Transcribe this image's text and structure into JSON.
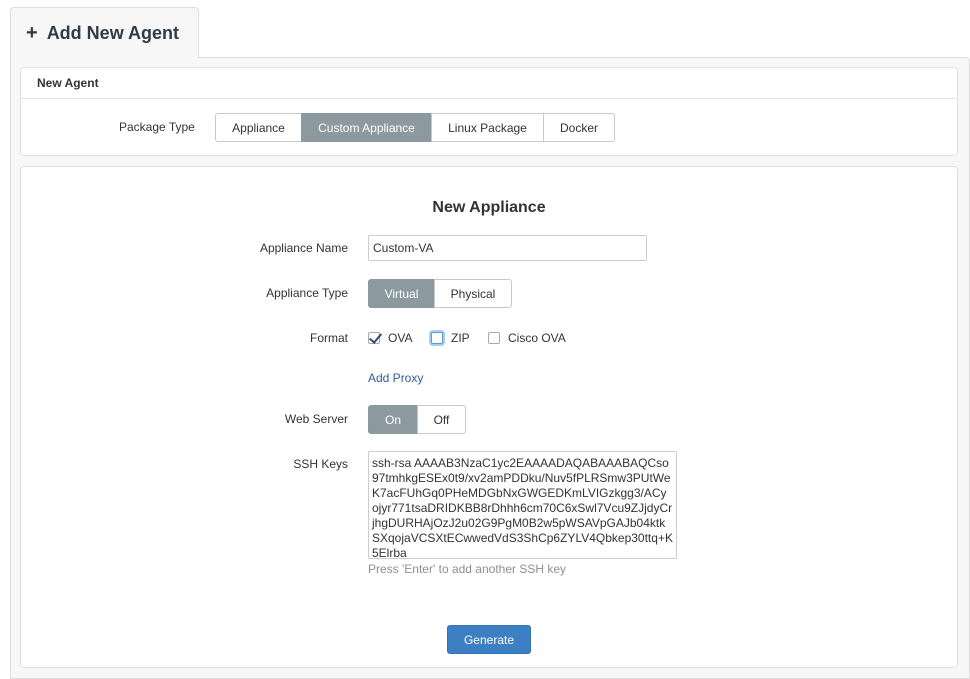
{
  "tab": {
    "icon": "plus-icon",
    "plus": "+",
    "title": "Add New Agent"
  },
  "new_agent": {
    "heading": "New Agent",
    "package_type_label": "Package Type",
    "package_types": [
      "Appliance",
      "Custom Appliance",
      "Linux Package",
      "Docker"
    ],
    "selected_package_type": "Custom Appliance"
  },
  "form": {
    "title": "New Appliance",
    "appliance_name_label": "Appliance Name",
    "appliance_name_value": "Custom-VA",
    "appliance_type_label": "Appliance Type",
    "appliance_types": [
      "Virtual",
      "Physical"
    ],
    "selected_appliance_type": "Virtual",
    "format_label": "Format",
    "formats": [
      {
        "label": "OVA",
        "checked": true
      },
      {
        "label": "ZIP",
        "checked": false
      },
      {
        "label": "Cisco OVA",
        "checked": false
      }
    ],
    "add_proxy": "Add Proxy",
    "web_server_label": "Web Server",
    "web_server_options": [
      "On",
      "Off"
    ],
    "selected_web_server": "On",
    "ssh_keys_label": "SSH Keys",
    "ssh_keys_value": "ssh-rsa AAAAB3NzaC1yc2EAAAADAQABAAABAQCso97tmhkgESEx0t9/xv2amPDDku/Nuv5fPLRSmw3PUtWeK7acFUhGq0PHeMDGbNxGWGEDKmLVIGzkgg3/ACyojyr771tsaDRIDKBB8rDhhh6cm70C6xSwl7Vcu9ZJjdyCrjhgDURHAjOzJ2u02G9PgM0B2w5pWSAVpGAJb04ktkSXqojaVCSXtECwwedVdS3ShCp6ZYLV4Qbkep30ttq+K5Elrba",
    "ssh_hint": "Press 'Enter' to add another SSH key",
    "generate_label": "Generate"
  },
  "colors": {
    "active_segment": "#8c9aa0",
    "primary_button": "#3d7fc4",
    "link": "#2b5f9e"
  }
}
